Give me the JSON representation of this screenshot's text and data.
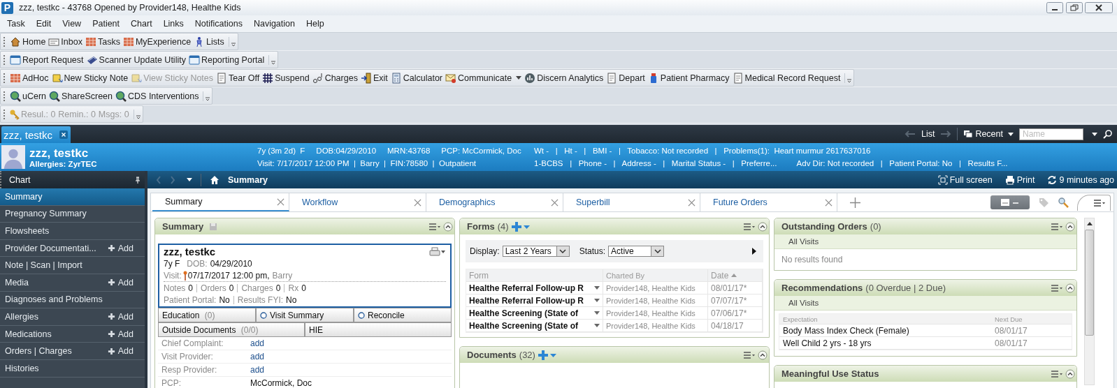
{
  "window": {
    "app_letter": "P",
    "title": "zzz, testkc - 43768 Opened by Provider148, Healthe Kids"
  },
  "menu": [
    "Task",
    "Edit",
    "View",
    "Patient",
    "Chart",
    "Links",
    "Notifications",
    "Navigation",
    "Help"
  ],
  "toolbars": [
    [
      {
        "label": "Home",
        "disabled": false,
        "dropdown": false
      },
      {
        "label": "Inbox",
        "disabled": false,
        "dropdown": false
      },
      {
        "label": "Tasks",
        "disabled": false,
        "dropdown": false
      },
      {
        "label": "MyExperience",
        "disabled": false,
        "dropdown": false
      },
      {
        "label": "Lists",
        "disabled": false,
        "dropdown": false
      }
    ],
    [
      {
        "label": "Report Request",
        "disabled": false,
        "dropdown": false
      },
      {
        "label": "Scanner Update Utility",
        "disabled": false,
        "dropdown": false
      },
      {
        "label": "Reporting Portal",
        "disabled": false,
        "dropdown": false
      }
    ],
    [
      {
        "label": "AdHoc",
        "disabled": false,
        "dropdown": false
      },
      {
        "label": "New Sticky Note",
        "disabled": false,
        "dropdown": false
      },
      {
        "label": "View Sticky Notes",
        "disabled": true,
        "dropdown": false
      },
      {
        "label": "Tear Off",
        "disabled": false,
        "dropdown": false
      },
      {
        "label": "Suspend",
        "disabled": false,
        "dropdown": false
      },
      {
        "label": "Charges",
        "disabled": false,
        "dropdown": false
      },
      {
        "label": "Exit",
        "disabled": false,
        "dropdown": false
      },
      {
        "label": "Calculator",
        "disabled": false,
        "dropdown": false
      },
      {
        "label": "Communicate",
        "disabled": false,
        "dropdown": true
      },
      {
        "label": "Discern Analytics",
        "disabled": false,
        "dropdown": false
      },
      {
        "label": "Depart",
        "disabled": false,
        "dropdown": false
      },
      {
        "label": "Patient Pharmacy",
        "disabled": false,
        "dropdown": false
      },
      {
        "label": "Medical Record Request",
        "disabled": false,
        "dropdown": false
      }
    ],
    [
      {
        "label": "uCern",
        "disabled": false,
        "dropdown": false
      },
      {
        "label": "ShareScreen",
        "disabled": false,
        "dropdown": false
      },
      {
        "label": "CDS Interventions",
        "disabled": false,
        "dropdown": false
      }
    ],
    [
      {
        "label": "Resul.: 0",
        "disabled": true,
        "dropdown": false
      },
      {
        "label": "Remin.: 0",
        "disabled": true,
        "dropdown": false
      },
      {
        "label": "Msgs: 0",
        "disabled": true,
        "dropdown": false
      }
    ]
  ],
  "patient_tab": {
    "label": "zzz, testkc"
  },
  "navigation": {
    "list": "List",
    "recent": "Recent",
    "search_placeholder": "Name"
  },
  "banner": {
    "name": "zzz, testkc",
    "allergies": "Allergies: ZyrTEC",
    "left_lines": [
      "7y (3m 2d)  F     DOB:04/29/2010     MRN:43768     PCP: McCormick, Doc",
      "Visit: 7/17/2017 12:00 PM  |  Barry  |  FIN:78580  |  Outpatient"
    ],
    "right_lines": [
      "Wt -   |   Ht -   |   BMI -   |   Tobacco: Not recorded   |   Problems(1):  Heart murmur 2617637016",
      "1-BCBS   |   Phone -   |   Address -   |   Marital Status -   |   Preferre...         Adv Dir: Not recorded   |   Patient Portal: No   |   Results F..."
    ]
  },
  "sidebar": {
    "title": "Chart",
    "items": [
      {
        "label": "Summary",
        "selected": true
      },
      {
        "label": "Pregnancy Summary",
        "selected": false
      },
      {
        "label": "Flowsheets",
        "selected": false
      },
      {
        "label": "Provider Documentati...",
        "selected": false,
        "action": "Add"
      },
      {
        "label": "Note | Scan | Import",
        "selected": false
      },
      {
        "label": "Media",
        "selected": false,
        "action": "Add"
      },
      {
        "label": "Diagnoses and Problems",
        "selected": false
      },
      {
        "label": "Allergies",
        "selected": false,
        "action": "Add"
      },
      {
        "label": "Medications",
        "selected": false,
        "action": "Add"
      },
      {
        "label": "Orders | Charges",
        "selected": false,
        "action": "Add"
      },
      {
        "label": "Histories",
        "selected": false
      }
    ]
  },
  "breadcrumb": "Summary",
  "page_actions": [
    "Full screen",
    "Print",
    "9 minutes ago"
  ],
  "tabs": [
    {
      "label": "Summary",
      "selected": true
    },
    {
      "label": "Workflow",
      "selected": false
    },
    {
      "label": "Demographics",
      "selected": false
    },
    {
      "label": "Superbill",
      "selected": false
    },
    {
      "label": "Future Orders",
      "selected": false
    }
  ],
  "summary_panel": {
    "title": "Summary",
    "name": "zzz, testkc",
    "age_sex": "7y F",
    "dob_label": "DOB:",
    "dob": "04/29/2010",
    "visit_label": "Visit:",
    "visit": "07/17/2017 12:00 pm,",
    "visit_provider": "Barry",
    "counts": [
      {
        "label": "Notes",
        "value": "0"
      },
      {
        "label": "Orders",
        "value": "0"
      },
      {
        "label": "Charges",
        "value": "0"
      },
      {
        "label": "Rx",
        "value": "0"
      }
    ],
    "portal": [
      {
        "label": "Patient Portal:",
        "value": "No"
      },
      {
        "label": "Results FYI:",
        "value": "No"
      }
    ],
    "buttons": [
      [
        {
          "label": "Education",
          "count": "(0)",
          "radio": false
        },
        {
          "label": "Visit Summary",
          "radio": true
        },
        {
          "label": "Reconcile",
          "radio": true
        }
      ],
      [
        {
          "label": "Outside Documents",
          "count": "(0/0)",
          "radio": false
        },
        {
          "label": "HIE",
          "radio": false
        }
      ]
    ],
    "fields": [
      {
        "label": "Chief Complaint:",
        "value": "add",
        "kind": "link"
      },
      {
        "label": "Visit Provider:",
        "value": "add",
        "kind": "link"
      },
      {
        "label": "Resp Provider:",
        "value": "add",
        "kind": "link"
      },
      {
        "label": "PCP:",
        "value": "McCormick, Doc",
        "kind": "text"
      }
    ]
  },
  "forms_panel": {
    "title": "Forms",
    "count": "(4)",
    "display_label": "Display:",
    "display": "Last 2 Years",
    "status_label": "Status:",
    "status": "Active",
    "columns": [
      "Form",
      "Charted By",
      "Date"
    ],
    "rows": [
      {
        "form": "Healthe Referral Follow-up R",
        "charted_by": "Provider148, Healthe Kids",
        "date": "08/01/17*"
      },
      {
        "form": "Healthe Referral Follow-up R",
        "charted_by": "Provider148, Healthe Kids",
        "date": "07/07/17*"
      },
      {
        "form": "Healthe Screening (State of",
        "charted_by": "Provider148, Healthe Kids",
        "date": "07/06/17*"
      },
      {
        "form": "Healthe Screening (State of",
        "charted_by": "Provider148, Healthe Kids",
        "date": "04/18/17"
      }
    ]
  },
  "documents_panel": {
    "title": "Documents",
    "count": "(32)"
  },
  "outstanding_orders": {
    "title": "Outstanding Orders",
    "count": "(0)",
    "filter": "All Visits",
    "empty": "No results found"
  },
  "recommendations": {
    "title": "Recommendations",
    "count": "(0 Overdue | 2 Due)",
    "filter": "All Visits",
    "columns": [
      "Expectation",
      "Next Due"
    ],
    "rows": [
      {
        "expectation": "Body Mass Index Check (Female)",
        "next_due": "08/01/17"
      },
      {
        "expectation": "Well Child 2 yrs - 18 yrs",
        "next_due": "08/01/17"
      }
    ]
  },
  "meaningful_use": {
    "title": "Meaningful Use Status"
  }
}
